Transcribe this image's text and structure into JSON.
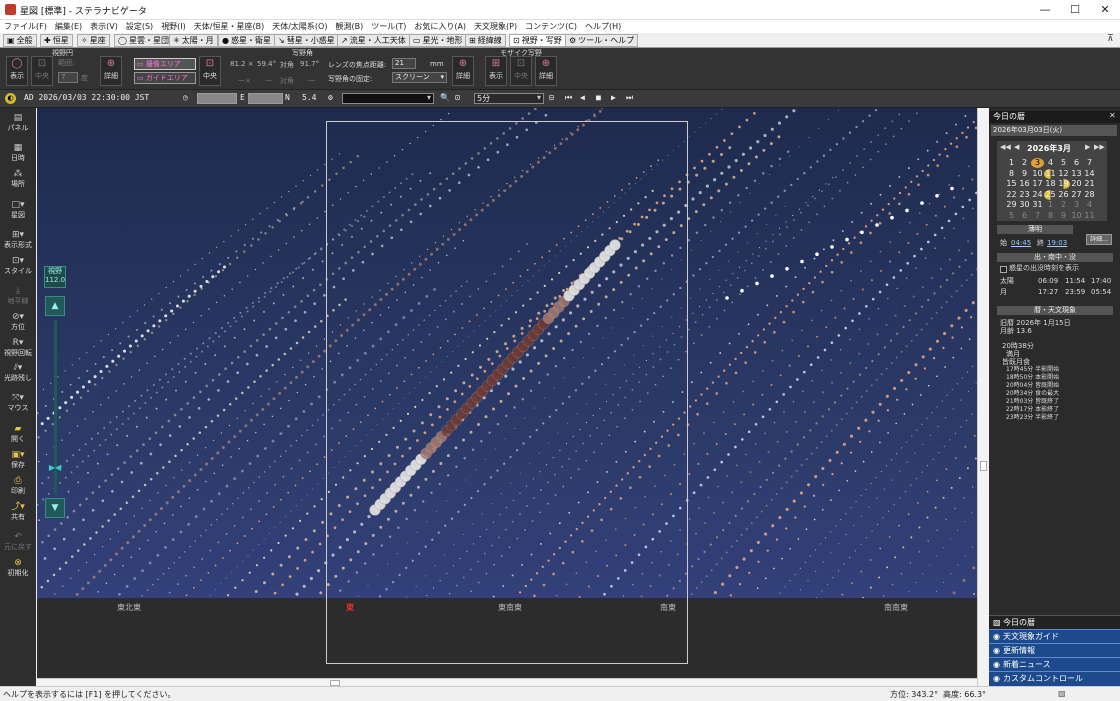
{
  "window": {
    "title": "星図 [標準] - ステラナビゲータ",
    "min_glyph": "—",
    "max_glyph": "☐",
    "close_glyph": "✕"
  },
  "menu": [
    "ファイル(F)",
    "編集(E)",
    "表示(V)",
    "設定(S)",
    "視野(I)",
    "天体/恒星・星座(B)",
    "天体/太陽系(O)",
    "観測(B)",
    "ツール(T)",
    "お気に入り(A)",
    "天文現象(P)",
    "コンテンツ(C)",
    "ヘルプ(H)"
  ],
  "tabs": [
    "全般",
    "恒星",
    "星座",
    "星雲・星団",
    "太陽・月",
    "惑星・衛星",
    "彗星・小惑星",
    "流星・人工天体",
    "星光・地形",
    "経緯線",
    "視野・写野",
    "ツール・ヘルプ"
  ],
  "ribbon": {
    "g1": "視野円",
    "g2": "写野角",
    "g3": "モザイク写野",
    "show": "表示",
    "center": "中央",
    "detail": "詳細",
    "range": "範囲:",
    "range_val": "7",
    "deg": "度",
    "area": "撮像エリア",
    "guide": "ガイドエリア",
    "fov1": "81.2 ×",
    "fov2": "59.4°",
    "fov3": "対角",
    "fov4": "91.7°",
    "sub1": "一×",
    "sub2": "一",
    "sub3": "対角",
    "sub4": "一",
    "focal_label": "レンズの焦点距離:",
    "focal_val": "21",
    "mm": "mm",
    "fix_label": "写野角の固定:",
    "fix_val": "スクリーン",
    "mosaic_show": "表示",
    "mosaic_center": "中央",
    "mosaic_detail": "詳細"
  },
  "infobar": {
    "datetime": "AD  2026/03/03  22:30:00  JST",
    "e_label": "E",
    "n_label": "N",
    "mag": "5.4",
    "step": "5分"
  },
  "left_tools": [
    "パネル",
    "日時",
    "場所",
    "星図",
    "表示形式",
    "スタイル",
    "地平線",
    "方位",
    "視野回転",
    "光跡残し",
    "マウス",
    "開く",
    "保存",
    "印刷",
    "共有",
    "元に戻す",
    "初期化"
  ],
  "fov_slider": {
    "label": "視野",
    "value": "112.0"
  },
  "directions": [
    "東北東",
    "東",
    "東南東",
    "南東",
    "南南東"
  ],
  "right_panel": {
    "header": "今日の暦",
    "date": "2026年03月03日(火)",
    "cal_month": "2026年3月",
    "cal_days": [
      [
        "1",
        "2",
        "3",
        "4",
        "5",
        "6",
        "7"
      ],
      [
        "8",
        "9",
        "10",
        "11",
        "12",
        "13",
        "14"
      ],
      [
        "15",
        "16",
        "17",
        "18",
        "19",
        "20",
        "21"
      ],
      [
        "22",
        "23",
        "24",
        "25",
        "26",
        "27",
        "28"
      ],
      [
        "29",
        "30",
        "31",
        "1",
        "2",
        "3",
        "4"
      ],
      [
        "5",
        "6",
        "7",
        "8",
        "9",
        "10",
        "11"
      ]
    ],
    "twilight": "薄明",
    "start_label": "始",
    "start": "04:45",
    "end_label": "終",
    "end": "19:03",
    "detail_btn": "詳細...",
    "rise_set": "出・南中・没",
    "checkbox": "惑星の出没時刻を表示",
    "sun_label": "太陽",
    "sun": [
      "06:09",
      "11:54",
      "17:40"
    ],
    "moon_label": "月",
    "moon": [
      "17:27",
      "23:59",
      "05:54"
    ],
    "events_head": "暦・天文現象",
    "lunar": "旧暦 2026年 1月15日",
    "moon_age": "月齢 13.6",
    "events": [
      "20時38分",
      "満月",
      "皆既月食",
      "17時45分  半影開始",
      "18時50分  本影開始",
      "20時04分  皆既開始",
      "20時34分  食の最大",
      "21時03分  皆既終了",
      "22時17分  本影終了",
      "23時23分  半影終了"
    ]
  },
  "nav": [
    "今日の暦",
    "天文現象ガイド",
    "更新情報",
    "新着ニュース",
    "カスタムコントロール"
  ],
  "status": {
    "help": "ヘルプを表示するには [F1] を押してください。",
    "az": "方位: 343.2°",
    "alt": "高度: 66.3°"
  }
}
